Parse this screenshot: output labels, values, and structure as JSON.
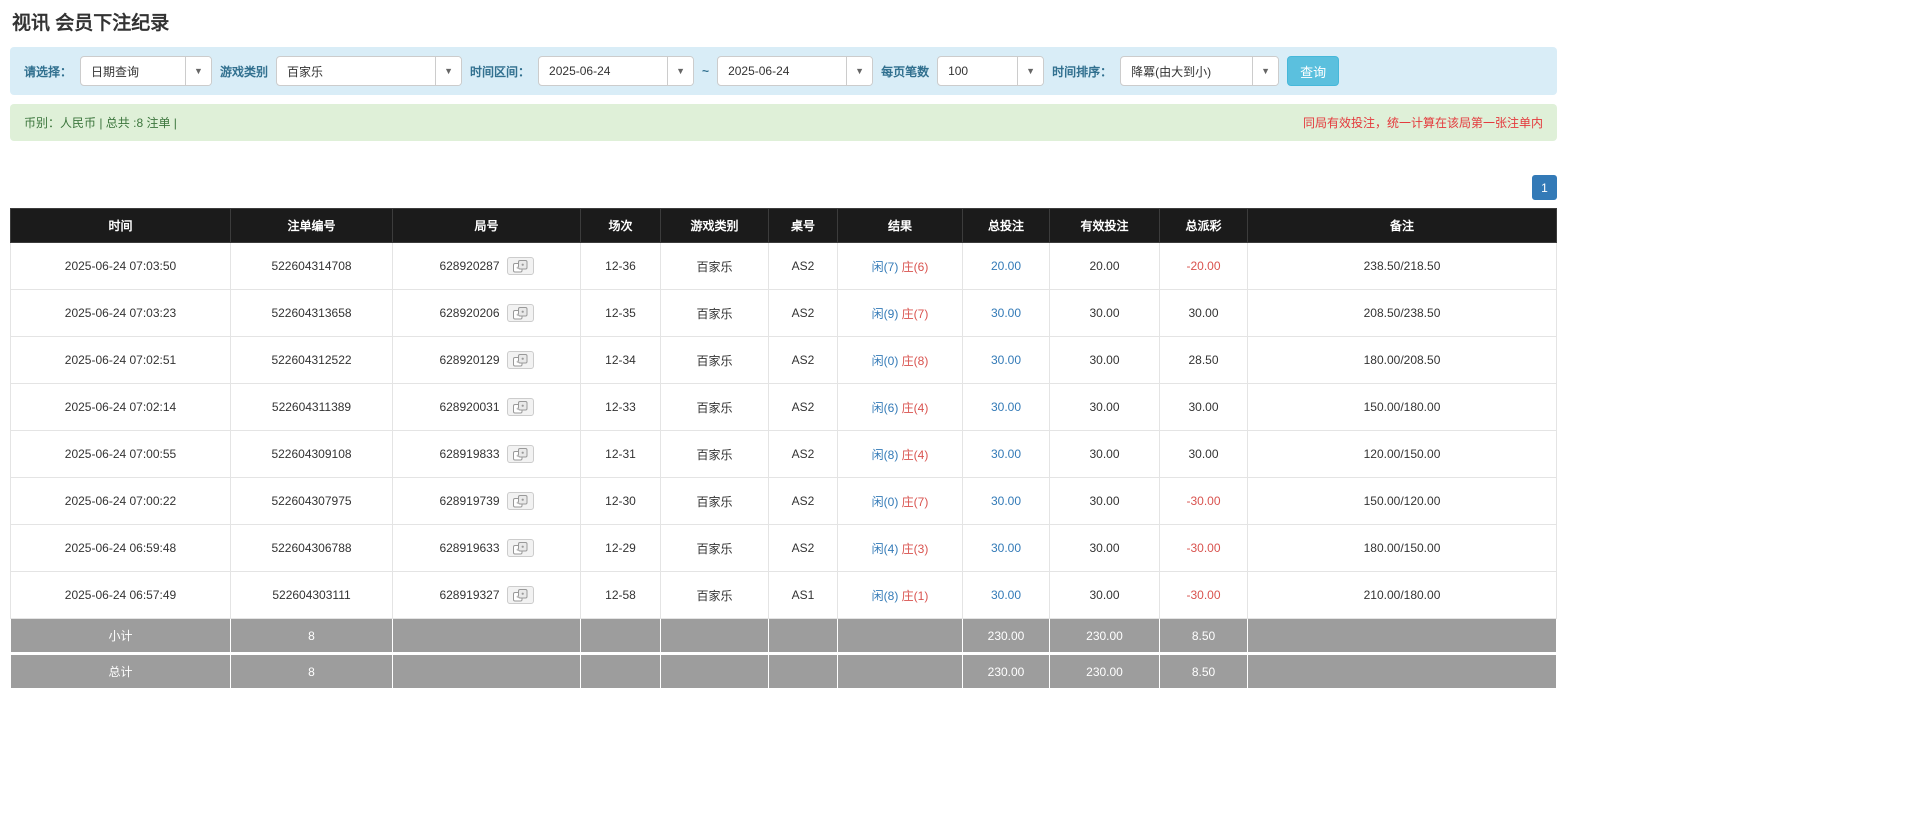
{
  "page": {
    "title": "视讯 会员下注纪录"
  },
  "filters": {
    "select_label": "请选择：",
    "select_value": "日期查询",
    "game_type_label": "游戏类别",
    "game_type_value": "百家乐",
    "time_range_label": "时间区间：",
    "time_from": "2025-06-24",
    "range_separator": "~",
    "time_to": "2025-06-24",
    "page_size_label": "每页笔数",
    "page_size_value": "100",
    "sort_label": "时间排序：",
    "sort_value": "降冪(由大到小)",
    "search_button_label": "查询"
  },
  "summary": {
    "currency_info": "币别：人民币 | 总共 :8 注单 |",
    "note": "同局有效投注，统一计算在该局第一张注单内"
  },
  "pagination": {
    "pages": [
      "1"
    ]
  },
  "colors": {
    "filter_bg": "#d9edf7",
    "filter_label": "#31708f",
    "summary_bg": "#dff0d8",
    "summary_text": "#3c763d",
    "note_red": "#e4393c",
    "search_button_bg": "#5bc0de",
    "header_bg": "#1b1b1b",
    "footer_bg": "#9d9d9d",
    "link_blue": "#337ab7",
    "player_blue": "#337ab7",
    "banker_red": "#d9534f",
    "negative_red": "#d9534f",
    "pagination_blue": "#337ab7"
  },
  "table": {
    "headers": [
      "时间",
      "注单编号",
      "局号",
      "场次",
      "游戏类别",
      "桌号",
      "结果",
      "总投注",
      "有效投注",
      "总派彩",
      "备注"
    ],
    "rows": [
      {
        "time": "2025-06-24 07:03:50",
        "bet_id": "522604314708",
        "round_id": "628920287",
        "session": "12-36",
        "game": "百家乐",
        "table": "AS2",
        "result_player": "闲(7)",
        "result_banker": "庄(6)",
        "total_bet": "20.00",
        "valid_bet": "20.00",
        "payout": "-20.00",
        "remark": "238.50/218.50"
      },
      {
        "time": "2025-06-24 07:03:23",
        "bet_id": "522604313658",
        "round_id": "628920206",
        "session": "12-35",
        "game": "百家乐",
        "table": "AS2",
        "result_player": "闲(9)",
        "result_banker": "庄(7)",
        "total_bet": "30.00",
        "valid_bet": "30.00",
        "payout": "30.00",
        "remark": "208.50/238.50"
      },
      {
        "time": "2025-06-24 07:02:51",
        "bet_id": "522604312522",
        "round_id": "628920129",
        "session": "12-34",
        "game": "百家乐",
        "table": "AS2",
        "result_player": "闲(0)",
        "result_banker": "庄(8)",
        "total_bet": "30.00",
        "valid_bet": "30.00",
        "payout": "28.50",
        "remark": "180.00/208.50"
      },
      {
        "time": "2025-06-24 07:02:14",
        "bet_id": "522604311389",
        "round_id": "628920031",
        "session": "12-33",
        "game": "百家乐",
        "table": "AS2",
        "result_player": "闲(6)",
        "result_banker": "庄(4)",
        "total_bet": "30.00",
        "valid_bet": "30.00",
        "payout": "30.00",
        "remark": "150.00/180.00"
      },
      {
        "time": "2025-06-24 07:00:55",
        "bet_id": "522604309108",
        "round_id": "628919833",
        "session": "12-31",
        "game": "百家乐",
        "table": "AS2",
        "result_player": "闲(8)",
        "result_banker": "庄(4)",
        "total_bet": "30.00",
        "valid_bet": "30.00",
        "payout": "30.00",
        "remark": "120.00/150.00"
      },
      {
        "time": "2025-06-24 07:00:22",
        "bet_id": "522604307975",
        "round_id": "628919739",
        "session": "12-30",
        "game": "百家乐",
        "table": "AS2",
        "result_player": "闲(0)",
        "result_banker": "庄(7)",
        "total_bet": "30.00",
        "valid_bet": "30.00",
        "payout": "-30.00",
        "remark": "150.00/120.00"
      },
      {
        "time": "2025-06-24 06:59:48",
        "bet_id": "522604306788",
        "round_id": "628919633",
        "session": "12-29",
        "game": "百家乐",
        "table": "AS2",
        "result_player": "闲(4)",
        "result_banker": "庄(3)",
        "total_bet": "30.00",
        "valid_bet": "30.00",
        "payout": "-30.00",
        "remark": "180.00/150.00"
      },
      {
        "time": "2025-06-24 06:57:49",
        "bet_id": "522604303111",
        "round_id": "628919327",
        "session": "12-58",
        "game": "百家乐",
        "table": "AS1",
        "result_player": "闲(8)",
        "result_banker": "庄(1)",
        "total_bet": "30.00",
        "valid_bet": "30.00",
        "payout": "-30.00",
        "remark": "210.00/180.00"
      }
    ],
    "subtotal": {
      "label": "小计",
      "count": "8",
      "total_bet": "230.00",
      "valid_bet": "230.00",
      "payout": "8.50"
    },
    "total": {
      "label": "总计",
      "count": "8",
      "total_bet": "230.00",
      "valid_bet": "230.00",
      "payout": "8.50"
    }
  }
}
